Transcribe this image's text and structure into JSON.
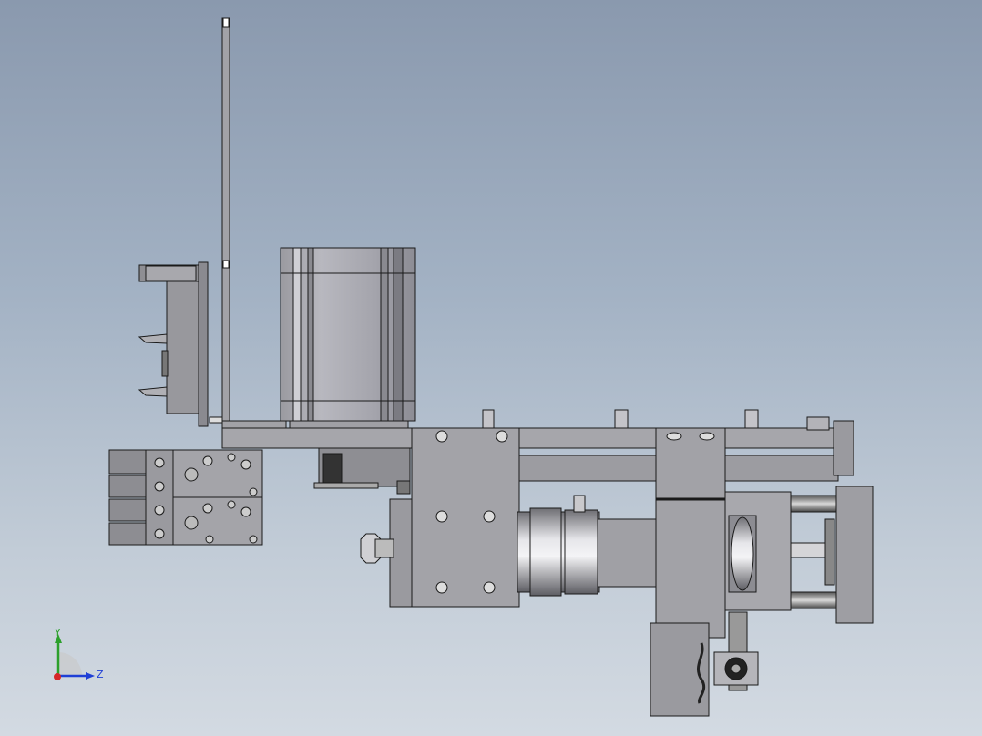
{
  "viewport": {
    "background_top": "#8a99ae",
    "background_bottom": "#d3dae2",
    "model_color": "#9a9a9e",
    "edge_color": "#1a1a1a"
  },
  "triad": {
    "y_label": "Y",
    "z_label": "Z",
    "y_color": "#2ca02c",
    "z_color": "#1f3fd6",
    "x_color": "#d62728"
  }
}
